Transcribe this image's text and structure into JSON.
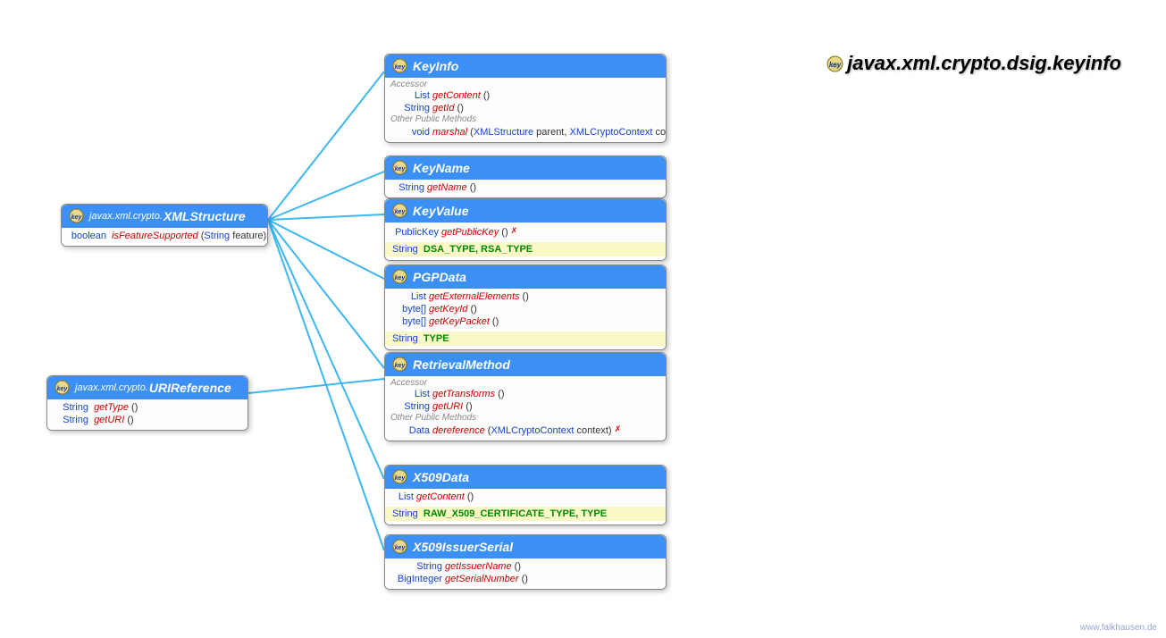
{
  "package_title": "javax.xml.crypto.dsig.keyinfo",
  "footer": "www.falkhausen.de",
  "xmlstructure": {
    "pkg": "javax.xml.crypto.",
    "name": "XMLStructure",
    "m1_ret": "boolean",
    "m1_name": "isFeatureSupported",
    "m1_p1_type": "String",
    "m1_p1_name": "feature"
  },
  "urireference": {
    "pkg": "javax.xml.crypto.",
    "name": "URIReference",
    "m1_ret": "String",
    "m1_name": "getType",
    "m2_ret": "String",
    "m2_name": "getURI"
  },
  "keyinfo": {
    "name": "KeyInfo",
    "sec1": "Accessor",
    "m1_ret": "List",
    "m1_name": "getContent",
    "m2_ret": "String",
    "m2_name": "getId",
    "sec2": "Other Public Methods",
    "m3_ret": "void",
    "m3_name": "marshal",
    "m3_p1_type": "XMLStructure",
    "m3_p1_name": "parent",
    "m3_p2_type": "XMLCryptoContext",
    "m3_p2_name": "context",
    "m3_throws": "✗"
  },
  "keyname": {
    "name": "KeyName",
    "m1_ret": "String",
    "m1_name": "getName"
  },
  "keyvalue": {
    "name": "KeyValue",
    "m1_ret": "PublicKey",
    "m1_name": "getPublicKey",
    "m1_throws": "✗",
    "c_type": "String",
    "c_names": "DSA_TYPE, RSA_TYPE"
  },
  "pgpdata": {
    "name": "PGPData",
    "m1_ret": "List",
    "m1_name": "getExternalElements",
    "m2_ret": "byte[]",
    "m2_name": "getKeyId",
    "m3_ret": "byte[]",
    "m3_name": "getKeyPacket",
    "c_type": "String",
    "c_names": "TYPE"
  },
  "retrieval": {
    "name": "RetrievalMethod",
    "sec1": "Accessor",
    "m1_ret": "List",
    "m1_name": "getTransforms",
    "m2_ret": "String",
    "m2_name": "getURI",
    "sec2": "Other Public Methods",
    "m3_ret": "Data",
    "m3_name": "dereference",
    "m3_p1_type": "XMLCryptoContext",
    "m3_p1_name": "context",
    "m3_throws": "✗"
  },
  "x509data": {
    "name": "X509Data",
    "m1_ret": "List",
    "m1_name": "getContent",
    "c_type": "String",
    "c_names": "RAW_X509_CERTIFICATE_TYPE, TYPE"
  },
  "x509issuer": {
    "name": "X509IssuerSerial",
    "m1_ret": "String",
    "m1_name": "getIssuerName",
    "m2_ret": "BigInteger",
    "m2_name": "getSerialNumber"
  }
}
